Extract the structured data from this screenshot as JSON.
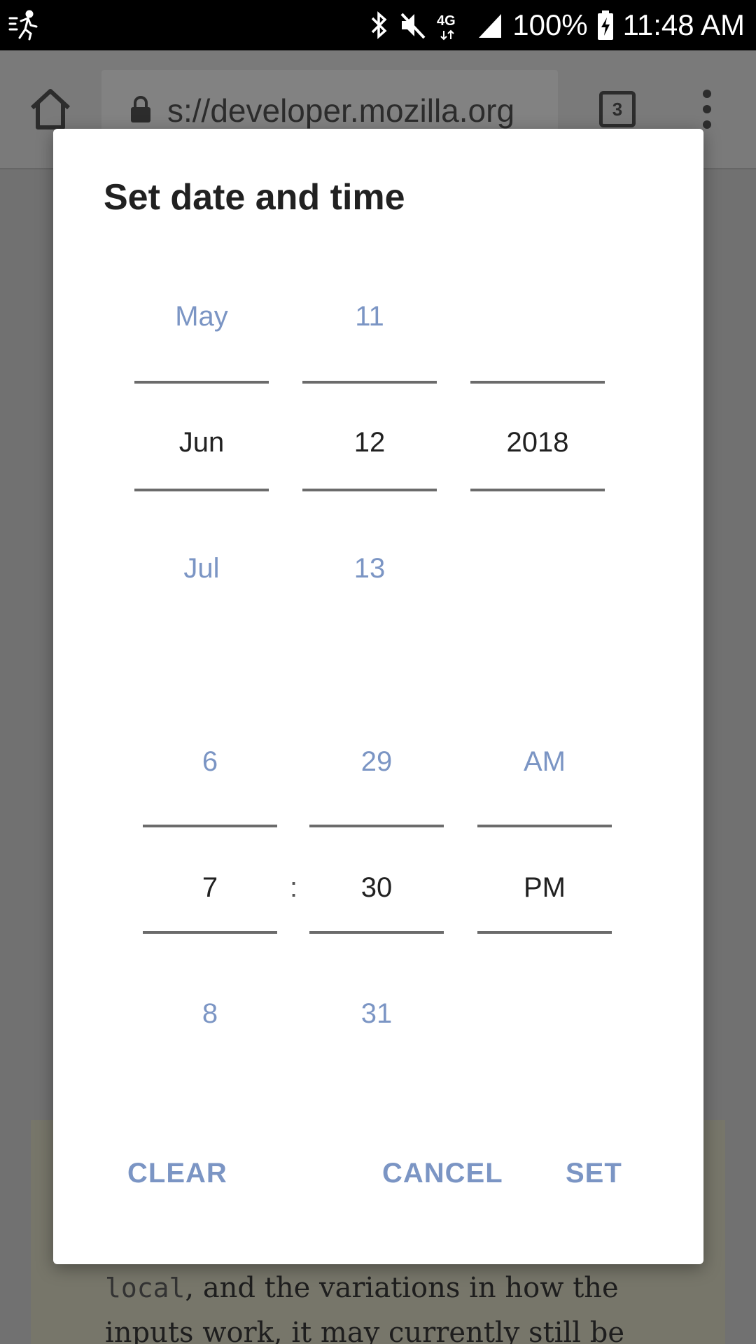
{
  "status_bar": {
    "battery": "100%",
    "time": "11:48 AM",
    "network": "4G",
    "icons": [
      "activity-icon",
      "bluetooth-icon",
      "mute-icon",
      "4g-lte-icon",
      "signal-icon",
      "battery-charging-icon"
    ]
  },
  "browser": {
    "url": "s://developer.mozilla.org",
    "tab_count": "3",
    "page_text_line1_code": "local",
    "page_text_line1": ", and the variations in how the",
    "page_text_line2": "inputs work, it may currently still be"
  },
  "dialog": {
    "title": "Set date and time",
    "date": {
      "month": {
        "prev": "May",
        "selected": "Jun",
        "next": "Jul"
      },
      "day": {
        "prev": "11",
        "selected": "12",
        "next": "13"
      },
      "year": {
        "prev": "",
        "selected": "2018",
        "next": ""
      }
    },
    "time": {
      "hour": {
        "prev": "6",
        "selected": "7",
        "next": "8"
      },
      "separator": ":",
      "minute": {
        "prev": "29",
        "selected": "30",
        "next": "31"
      },
      "ampm": {
        "prev": "AM",
        "selected": "PM",
        "next": ""
      }
    },
    "buttons": {
      "clear": "CLEAR",
      "cancel": "CANCEL",
      "set": "SET"
    }
  },
  "colors": {
    "accent": "#7b95c4",
    "title": "#212121",
    "scrim": "#6f6f6f"
  }
}
